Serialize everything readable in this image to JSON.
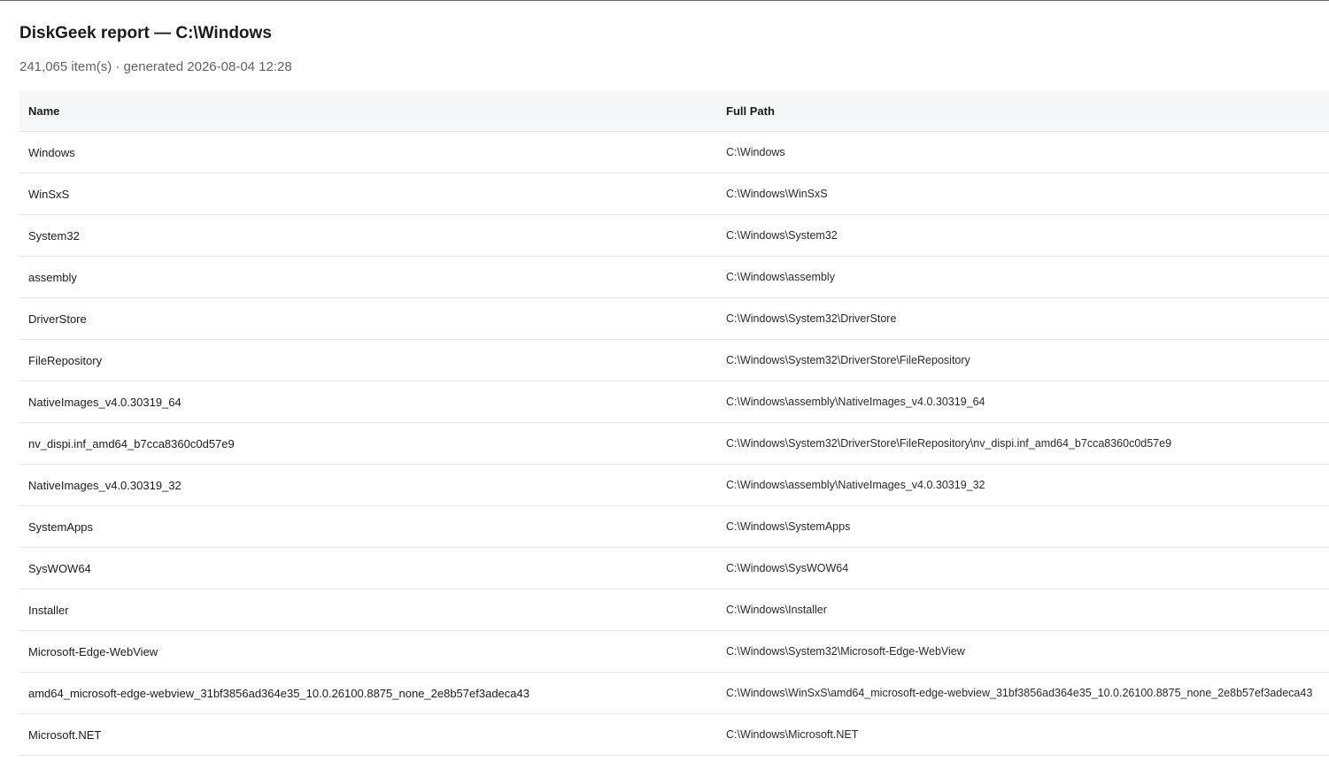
{
  "report": {
    "title": "DiskGeek report — C:\\Windows",
    "subtitle": "241,065 item(s) · generated 2026-08-04 12:28"
  },
  "table": {
    "columns": [
      "Name",
      "Full Path"
    ],
    "rows": [
      {
        "name": "Windows",
        "path": "C:\\Windows"
      },
      {
        "name": "WinSxS",
        "path": "C:\\Windows\\WinSxS"
      },
      {
        "name": "System32",
        "path": "C:\\Windows\\System32"
      },
      {
        "name": "assembly",
        "path": "C:\\Windows\\assembly"
      },
      {
        "name": "DriverStore",
        "path": "C:\\Windows\\System32\\DriverStore"
      },
      {
        "name": "FileRepository",
        "path": "C:\\Windows\\System32\\DriverStore\\FileRepository"
      },
      {
        "name": "NativeImages_v4.0.30319_64",
        "path": "C:\\Windows\\assembly\\NativeImages_v4.0.30319_64"
      },
      {
        "name": "nv_dispi.inf_amd64_b7cca8360c0d57e9",
        "path": "C:\\Windows\\System32\\DriverStore\\FileRepository\\nv_dispi.inf_amd64_b7cca8360c0d57e9"
      },
      {
        "name": "NativeImages_v4.0.30319_32",
        "path": "C:\\Windows\\assembly\\NativeImages_v4.0.30319_32"
      },
      {
        "name": "SystemApps",
        "path": "C:\\Windows\\SystemApps"
      },
      {
        "name": "SysWOW64",
        "path": "C:\\Windows\\SysWOW64"
      },
      {
        "name": "Installer",
        "path": "C:\\Windows\\Installer"
      },
      {
        "name": "Microsoft-Edge-WebView",
        "path": "C:\\Windows\\System32\\Microsoft-Edge-WebView"
      },
      {
        "name": "amd64_microsoft-edge-webview_31bf3856ad364e35_10.0.26100.8875_none_2e8b57ef3adeca43",
        "path": "C:\\Windows\\WinSxS\\amd64_microsoft-edge-webview_31bf3856ad364e35_10.0.26100.8875_none_2e8b57ef3adeca43"
      },
      {
        "name": "Microsoft.NET",
        "path": "C:\\Windows\\Microsoft.NET"
      }
    ]
  }
}
